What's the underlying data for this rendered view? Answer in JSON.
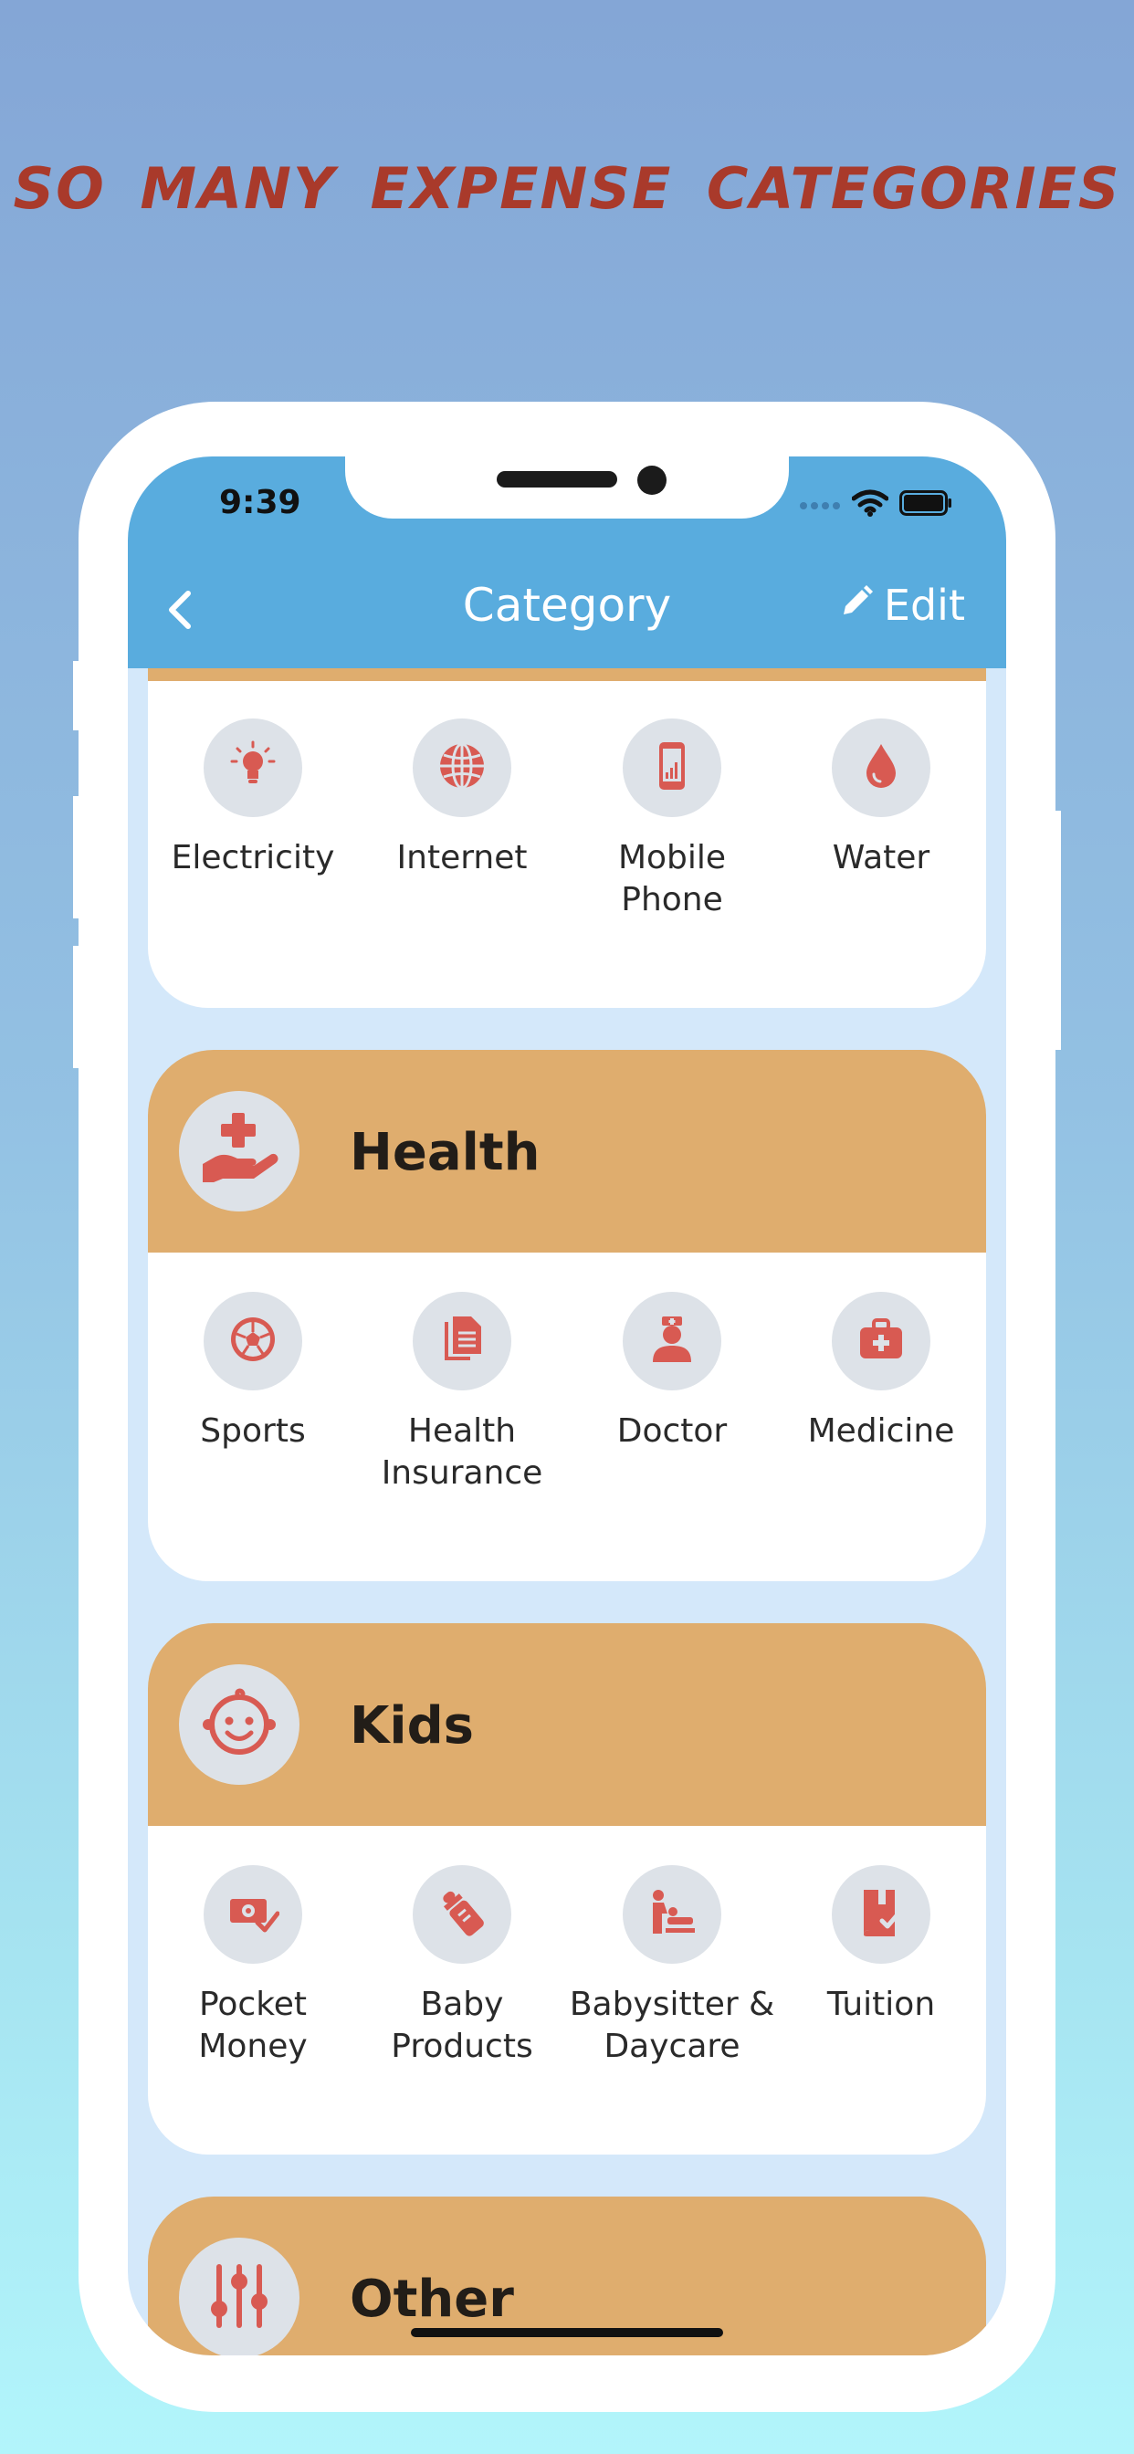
{
  "headline": "SO MANY EXPENSE CATEGORIES",
  "status_bar": {
    "time": "9:39"
  },
  "nav": {
    "title": "Category",
    "edit_label": "Edit"
  },
  "colors": {
    "accent_red": "#d85a52",
    "header_tan": "#dfad6e",
    "navbar_blue": "#59acde"
  },
  "groups": [
    {
      "title": "",
      "items": [
        {
          "label": "Electricity",
          "icon": "lightbulb-icon"
        },
        {
          "label": "Internet",
          "icon": "globe-icon"
        },
        {
          "label": "Mobile\nPhone",
          "icon": "mobile-phone-icon"
        },
        {
          "label": "Water",
          "icon": "water-drop-icon"
        }
      ]
    },
    {
      "title": "Health",
      "icon": "hand-medical-icon",
      "items": [
        {
          "label": "Sports",
          "icon": "soccer-ball-icon"
        },
        {
          "label": "Health\nInsurance",
          "icon": "documents-icon"
        },
        {
          "label": "Doctor",
          "icon": "doctor-icon"
        },
        {
          "label": "Medicine",
          "icon": "first-aid-kit-icon"
        }
      ]
    },
    {
      "title": "Kids",
      "icon": "baby-face-icon",
      "items": [
        {
          "label": "Pocket\nMoney",
          "icon": "money-check-icon"
        },
        {
          "label": "Baby\nProducts",
          "icon": "baby-bottle-icon"
        },
        {
          "label": "Babysitter &\nDaycare",
          "icon": "baby-changing-icon"
        },
        {
          "label": "Tuition",
          "icon": "book-check-icon"
        }
      ]
    },
    {
      "title": "Other",
      "icon": "sliders-icon",
      "items": []
    }
  ]
}
